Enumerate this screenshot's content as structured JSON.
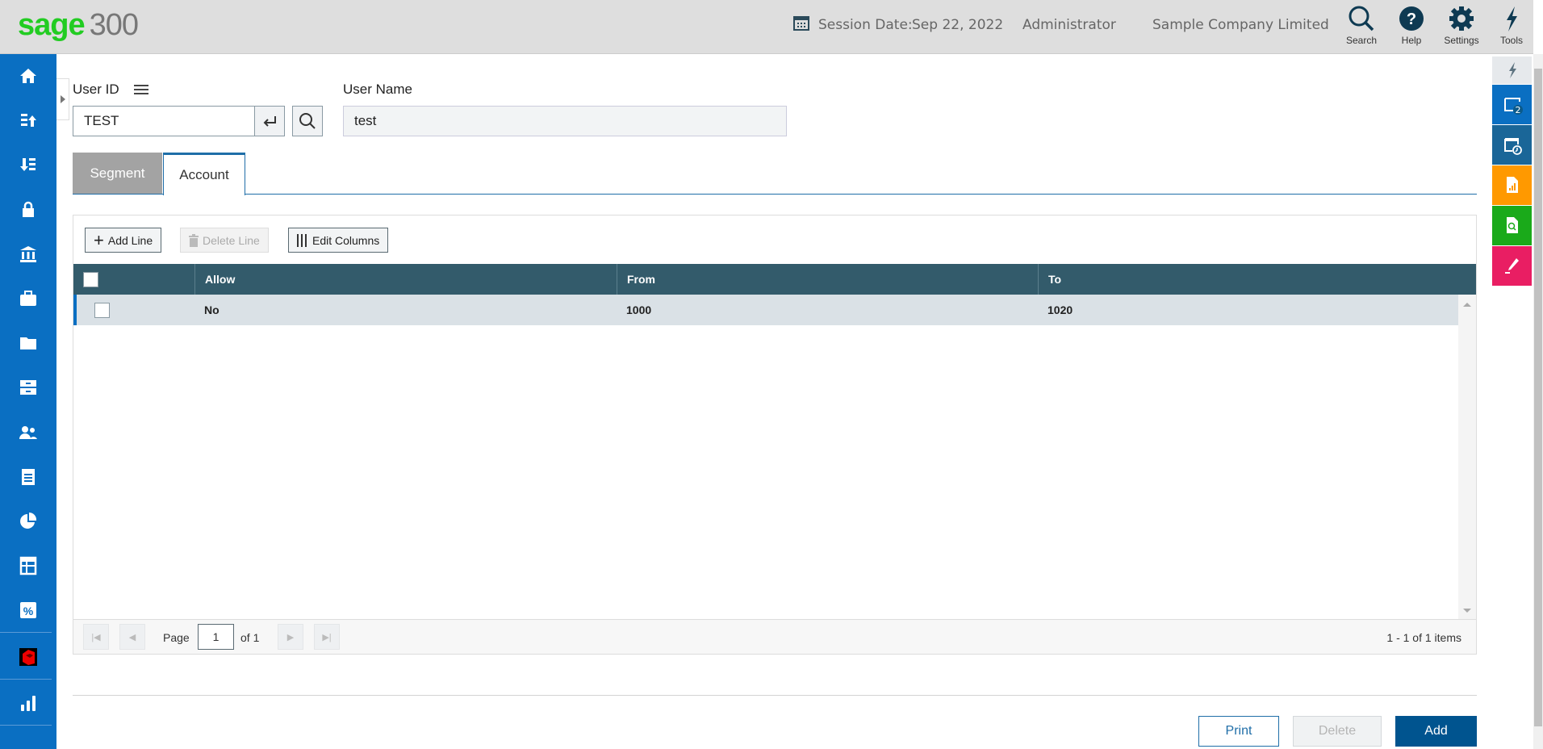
{
  "header": {
    "logo_brand": "sage",
    "logo_product": "300",
    "session_date_label": "Session Date:",
    "session_date": "Sep 22, 2022",
    "user": "Administrator",
    "company": "Sample Company Limited",
    "buttons": [
      {
        "label": "Search",
        "icon": "search-icon"
      },
      {
        "label": "Help",
        "icon": "help-icon"
      },
      {
        "label": "Settings",
        "icon": "gear-icon"
      },
      {
        "label": "Tools",
        "icon": "lightning-icon"
      }
    ]
  },
  "sidebar": {
    "items": [
      "home-icon",
      "sort-up-icon",
      "sort-down-icon",
      "lock-icon",
      "bank-icon",
      "briefcase-icon",
      "folder-icon",
      "archive-icon",
      "users-icon",
      "document-icon",
      "pie-chart-icon",
      "table-icon",
      "percent-icon",
      "app-cube-icon",
      "bar-chart-icon"
    ]
  },
  "form": {
    "user_id_label": "User ID",
    "user_id_value": "TEST",
    "user_name_label": "User Name",
    "user_name_value": "test"
  },
  "tabs": [
    {
      "label": "Segment",
      "active": false
    },
    {
      "label": "Account",
      "active": true
    }
  ],
  "grid": {
    "toolbar": {
      "add_line": "Add Line",
      "delete_line": "Delete Line",
      "edit_columns": "Edit Columns"
    },
    "columns": [
      "Allow",
      "From",
      "To"
    ],
    "rows": [
      {
        "allow": "No",
        "from": "1000",
        "to": "1020",
        "checked": false
      }
    ],
    "pager": {
      "page_label": "Page",
      "page": "1",
      "of_label": "of 1",
      "summary": "1 - 1 of 1 items"
    }
  },
  "actions": {
    "print": "Print",
    "delete": "Delete",
    "add": "Add"
  },
  "right_panel": {
    "badge": "2",
    "tiles": [
      {
        "icon": "windows-icon",
        "color": "#0a6fc2"
      },
      {
        "icon": "window-clock-icon",
        "color": "#1a6698"
      },
      {
        "icon": "report-icon",
        "color": "#ff9900"
      },
      {
        "icon": "document-search-icon",
        "color": "#1aaa1a"
      },
      {
        "icon": "pen-icon",
        "color": "#e91e63"
      }
    ]
  },
  "colors": {
    "sidebar": "#0a6fc2",
    "grid_header": "#335b6b",
    "primary_button": "#00548f",
    "brand_green": "#22cc22"
  }
}
